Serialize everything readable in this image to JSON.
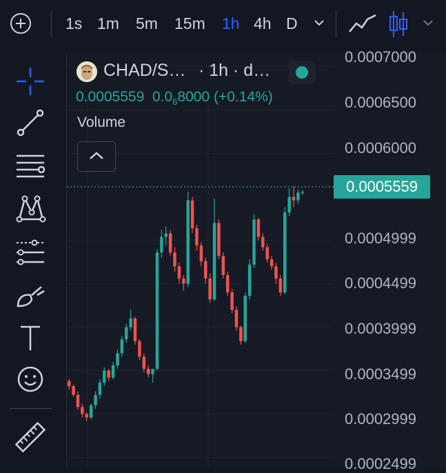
{
  "toolbar": {
    "intervals": [
      {
        "label": "1s",
        "active": false
      },
      {
        "label": "1m",
        "active": false
      },
      {
        "label": "5m",
        "active": false
      },
      {
        "label": "15m",
        "active": false
      },
      {
        "label": "1h",
        "active": true
      },
      {
        "label": "4h",
        "active": false
      },
      {
        "label": "D",
        "active": false
      }
    ],
    "active_color": "#2962ff"
  },
  "legend": {
    "symbol": "CHAD/S…",
    "meta": "· 1h · d…",
    "price": "0.0005559",
    "change_prefix": "0.0",
    "change_sub": "6",
    "change_suffix": "8000",
    "change_pct": "(+0.14%)",
    "volume_label": "Volume",
    "status_color": "#26a69a"
  },
  "price_scale": {
    "ticks": [
      "0.0007000",
      "0.0006500",
      "0.0006000",
      "0.0004999",
      "0.0004499",
      "0.0003999",
      "0.0003499",
      "0.0002999",
      "0.0002499"
    ],
    "current_price_label": "0.0005559"
  },
  "chart_data": {
    "type": "candlestick",
    "interval": "1h",
    "last_price": 0.0005559,
    "ylim": [
      0.00024,
      0.00071
    ],
    "up_color": "#26a69a",
    "down_color": "#ef5350",
    "candles": [
      [
        0.000338,
        0.00034,
        0.000328,
        0.000332
      ],
      [
        0.000332,
        0.000334,
        0.00032,
        0.000322
      ],
      [
        0.000322,
        0.000326,
        0.000305,
        0.000308
      ],
      [
        0.000308,
        0.000312,
        0.000296,
        0.0003
      ],
      [
        0.0003,
        0.000302,
        0.000292,
        0.000296
      ],
      [
        0.000296,
        0.000312,
        0.000294,
        0.00031
      ],
      [
        0.00031,
        0.000326,
        0.000306,
        0.000322
      ],
      [
        0.000322,
        0.00034,
        0.000318,
        0.000336
      ],
      [
        0.000336,
        0.000354,
        0.000332,
        0.00035
      ],
      [
        0.00035,
        0.000352,
        0.000338,
        0.000342
      ],
      [
        0.000342,
        0.00036,
        0.00034,
        0.000356
      ],
      [
        0.000356,
        0.000374,
        0.000352,
        0.00037
      ],
      [
        0.00037,
        0.00039,
        0.000366,
        0.000386
      ],
      [
        0.000386,
        0.000404,
        0.000382,
        0.0004
      ],
      [
        0.0004,
        0.00042,
        0.000396,
        0.00041
      ],
      [
        0.00041,
        0.000412,
        0.00038,
        0.000384
      ],
      [
        0.000384,
        0.000386,
        0.000362,
        0.000366
      ],
      [
        0.000366,
        0.00037,
        0.000348,
        0.000352
      ],
      [
        0.000352,
        0.000356,
        0.000342,
        0.000346
      ],
      [
        0.000346,
        0.00035,
        0.000336,
        0.000352
      ],
      [
        0.000352,
        0.00049,
        0.00035,
        0.000486
      ],
      [
        0.000486,
        0.000512,
        0.00048,
        0.000504
      ],
      [
        0.000504,
        0.000516,
        0.000494,
        0.000508
      ],
      [
        0.000508,
        0.000512,
        0.000482,
        0.000486
      ],
      [
        0.000486,
        0.000492,
        0.000464,
        0.00047
      ],
      [
        0.00047,
        0.000474,
        0.00045,
        0.000456
      ],
      [
        0.000456,
        0.00046,
        0.000442,
        0.00045
      ],
      [
        0.00045,
        0.000556,
        0.000446,
        0.000546
      ],
      [
        0.000546,
        0.00055,
        0.000508,
        0.000514
      ],
      [
        0.000514,
        0.000518,
        0.000488,
        0.000494
      ],
      [
        0.000494,
        0.000498,
        0.00047,
        0.000476
      ],
      [
        0.000476,
        0.00048,
        0.00045,
        0.000456
      ],
      [
        0.000456,
        0.000462,
        0.000428,
        0.000432
      ],
      [
        0.000432,
        0.000548,
        0.00043,
        0.00052
      ],
      [
        0.00052,
        0.000524,
        0.000478,
        0.000482
      ],
      [
        0.000482,
        0.000486,
        0.000456,
        0.00046
      ],
      [
        0.00046,
        0.000464,
        0.000436,
        0.00044
      ],
      [
        0.00044,
        0.000444,
        0.000416,
        0.00042
      ],
      [
        0.00042,
        0.000424,
        0.000396,
        0.0004
      ],
      [
        0.0004,
        0.000402,
        0.00038,
        0.000384
      ],
      [
        0.000384,
        0.00044,
        0.000382,
        0.000436
      ],
      [
        0.000436,
        0.000478,
        0.000432,
        0.000472
      ],
      [
        0.000472,
        0.00053,
        0.000468,
        0.000524
      ],
      [
        0.000524,
        0.000526,
        0.0005,
        0.000504
      ],
      [
        0.000504,
        0.000508,
        0.000488,
        0.000492
      ],
      [
        0.000492,
        0.000496,
        0.000474,
        0.000478
      ],
      [
        0.000478,
        0.000482,
        0.000466,
        0.00047
      ],
      [
        0.00047,
        0.000474,
        0.00045,
        0.000456
      ],
      [
        0.000456,
        0.00046,
        0.000436,
        0.00044
      ],
      [
        0.00044,
        0.000538,
        0.000438,
        0.000532
      ],
      [
        0.000532,
        0.00056,
        0.000528,
        0.00055
      ],
      [
        0.00055,
        0.000562,
        0.000538,
        0.000546
      ],
      [
        0.000546,
        0.000558,
        0.000542,
        0.000555
      ],
      [
        0.000555,
        0.000558,
        0.000552,
        0.0005559
      ]
    ]
  }
}
